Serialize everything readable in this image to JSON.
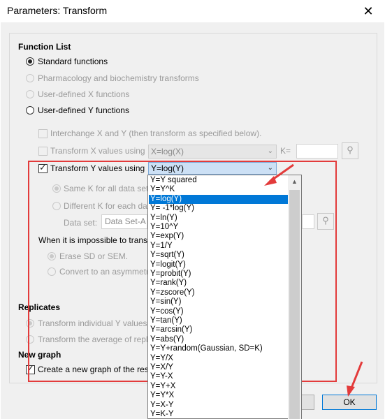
{
  "window": {
    "title": "Parameters: Transform",
    "close_label": "✕"
  },
  "function_list": {
    "heading": "Function List",
    "options": [
      {
        "label": "Standard functions",
        "selected": true,
        "enabled": true
      },
      {
        "label": "Pharmacology and biochemistry transforms",
        "selected": false,
        "enabled": false
      },
      {
        "label": "User-defined X functions",
        "selected": false,
        "enabled": false
      },
      {
        "label": "User-defined Y functions",
        "selected": false,
        "enabled": true
      }
    ]
  },
  "interchange": {
    "label": "Interchange X and Y (then transform as specified below).",
    "checked": false
  },
  "transform_x": {
    "label": "Transform X values using",
    "checked": false,
    "value": "X=log(X)",
    "k_label": "K=",
    "k_value": ""
  },
  "transform_y": {
    "label": "Transform Y values using",
    "checked": true,
    "value": "Y=log(Y)"
  },
  "k_mode": {
    "same": "Same K for all data sets.",
    "different": "Different K for each data",
    "dataset_label": "Data set:",
    "dataset_value": "Data Set-A"
  },
  "impossible": {
    "text": "When it is impossible to transfo",
    "erase": "Erase SD or SEM.",
    "convert": "Convert to an asymmetric"
  },
  "replicates": {
    "heading": "Replicates",
    "individual": "Transform individual Y values",
    "average": "Transform the average of replica"
  },
  "new_graph": {
    "heading": "New graph",
    "create": "Create a new graph of the result",
    "checked": true
  },
  "dropdown": {
    "selected_index": 2,
    "items": [
      "Y=Y squared",
      "Y=Y^K",
      "Y=log(Y)",
      "Y= -1*log(Y)",
      "Y=ln(Y)",
      "Y=10^Y",
      "Y=exp(Y)",
      "Y=1/Y",
      "Y=sqrt(Y)",
      "Y=logit(Y)",
      "Y=probit(Y)",
      "Y=rank(Y)",
      "Y=zscore(Y)",
      "Y=sin(Y)",
      "Y=cos(Y)",
      "Y=tan(Y)",
      "Y=arcsin(Y)",
      "Y=abs(Y)",
      "Y=Y+random(Gaussian, SD=K)",
      "Y=Y/X",
      "Y=X/Y",
      "Y=Y-X",
      "Y=Y+X",
      "Y=Y*X",
      "Y=X-Y",
      "Y=K-Y"
    ]
  },
  "buttons": {
    "ok": "OK"
  },
  "colors": {
    "highlight": "#0078d7",
    "annotation": "#e33b3b"
  }
}
